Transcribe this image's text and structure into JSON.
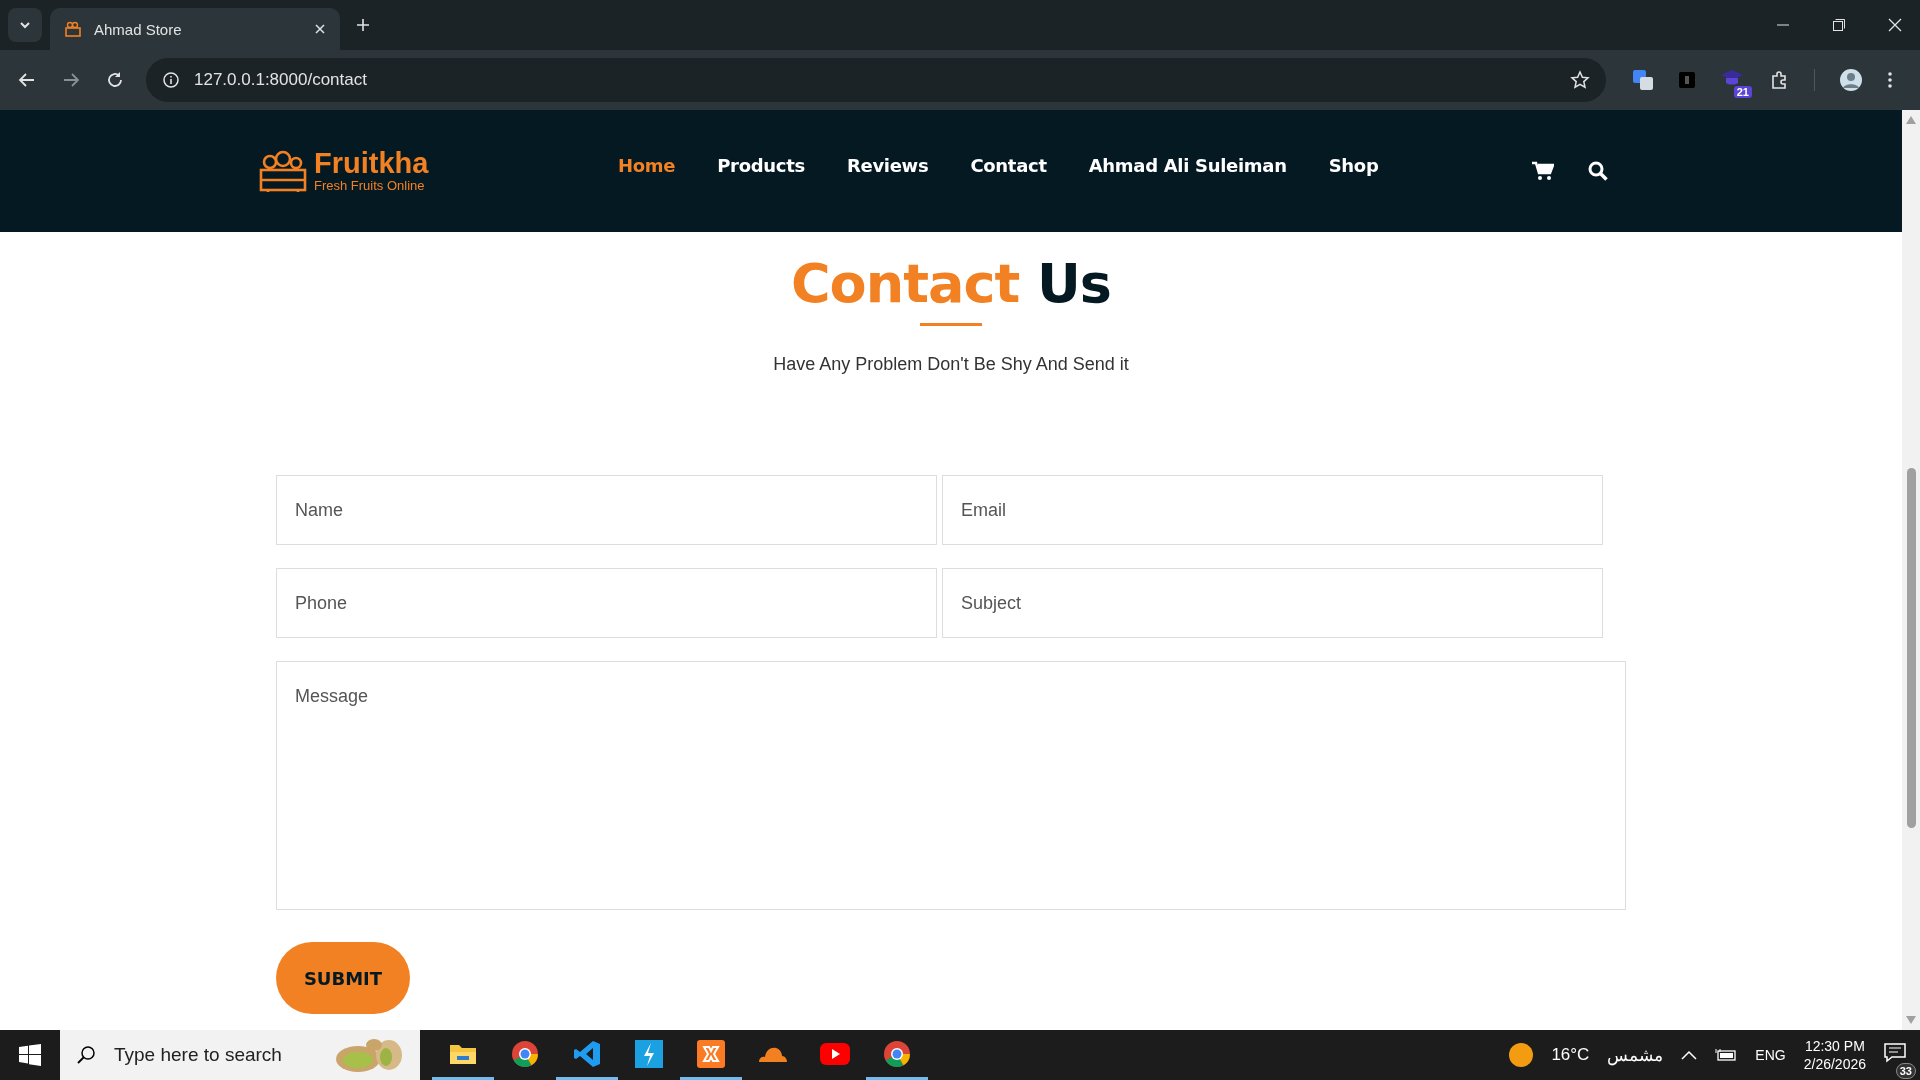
{
  "browser": {
    "tabs": [
      {
        "title": "Ahmad Store",
        "selected": true
      }
    ],
    "url": "127.0.0.1:8000/contact",
    "extension_badge": "21"
  },
  "site": {
    "logo": {
      "name": "Fruitkha",
      "tagline": "Fresh Fruits Online"
    },
    "nav": [
      {
        "label": "Home",
        "selected": true
      },
      {
        "label": "Products",
        "selected": false
      },
      {
        "label": "Reviews",
        "selected": false
      },
      {
        "label": "Contact",
        "selected": false
      },
      {
        "label": "Ahmad Ali Suleiman",
        "selected": false
      },
      {
        "label": "Shop",
        "selected": false
      }
    ],
    "heading": {
      "accent": "Contact",
      "rest": "Us"
    },
    "subtitle": "Have Any Problem Don't Be Shy And Send it",
    "fields": [
      {
        "kind": "input",
        "placeholder": "Name"
      },
      {
        "kind": "input",
        "placeholder": "Email"
      },
      {
        "kind": "input",
        "placeholder": "Phone"
      },
      {
        "kind": "input",
        "placeholder": "Subject"
      },
      {
        "kind": "textarea",
        "placeholder": "Message"
      }
    ],
    "submit": "SUBMIT"
  },
  "taskbar": {
    "search": {
      "placeholder": "Type here to search"
    },
    "apps": [
      {
        "kind": "folder",
        "running": true
      },
      {
        "kind": "chrome",
        "running": false
      },
      {
        "kind": "vscode",
        "running": true
      },
      {
        "kind": "bolt",
        "running": false
      },
      {
        "kind": "xampp",
        "running": true
      },
      {
        "kind": "cloud",
        "running": false
      },
      {
        "kind": "youtube",
        "running": false
      },
      {
        "kind": "chrome",
        "running": true
      }
    ],
    "weather": {
      "temp": "16°C",
      "condition": "مشمس"
    },
    "language": "ENG",
    "time": "12:30 PM",
    "date": "2/26/2026",
    "notifications": "33"
  }
}
